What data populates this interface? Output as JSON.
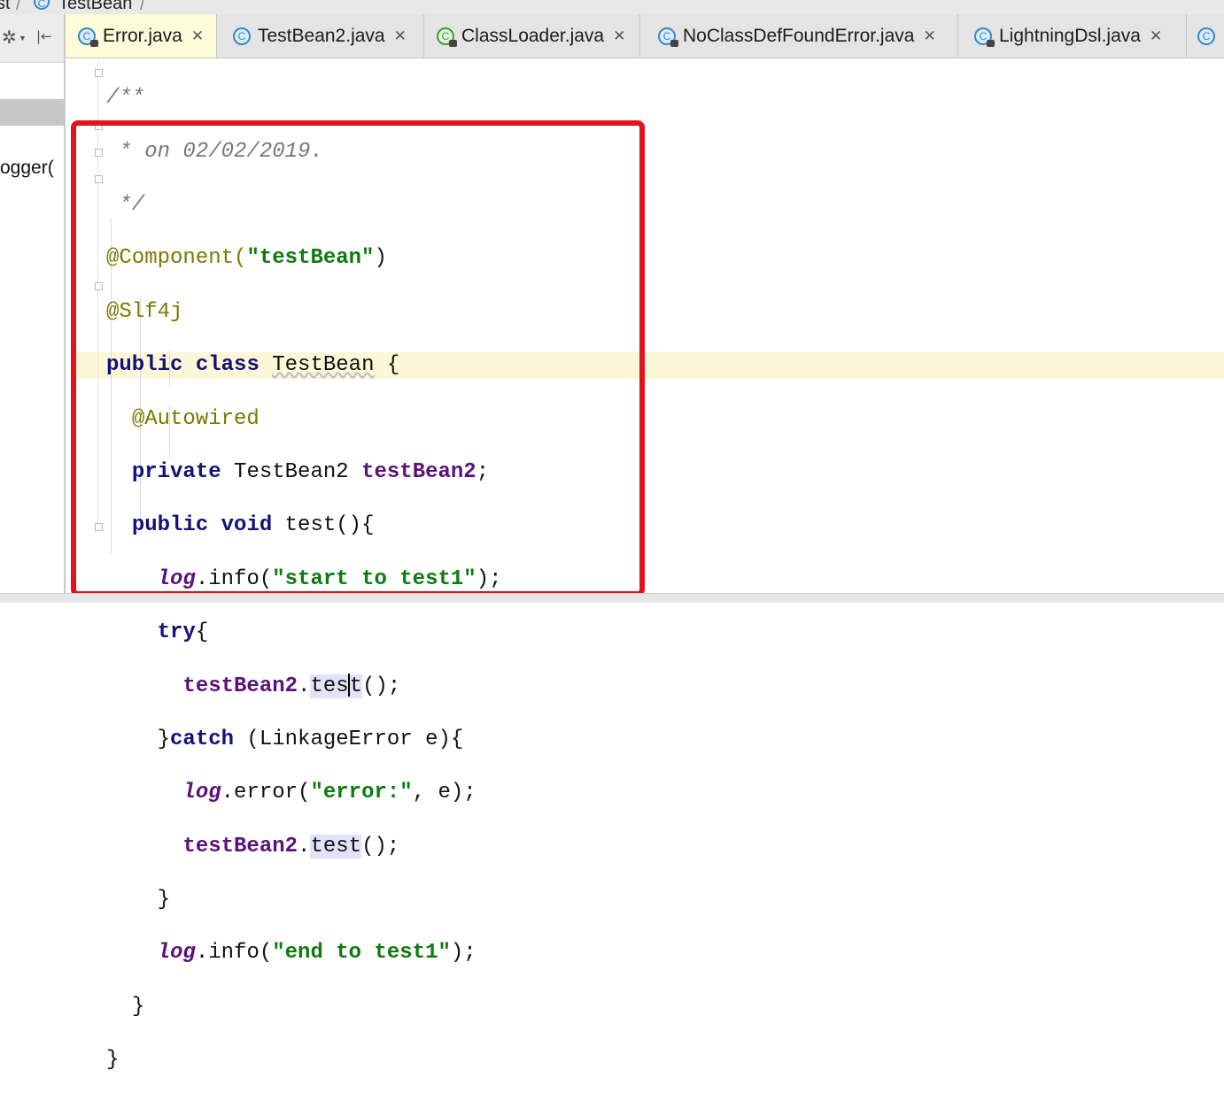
{
  "breadcrumb": {
    "prev": "st",
    "icon": "class-icon",
    "current": "TestBean"
  },
  "left_panel": {
    "partial_text": "ogger("
  },
  "tabs": [
    {
      "label": "Error.java",
      "icon": "class-lock-icon",
      "active": true
    },
    {
      "label": "TestBean2.java",
      "icon": "class-icon",
      "active": false
    },
    {
      "label": "ClassLoader.java",
      "icon": "class-green-lock-icon",
      "active": false
    },
    {
      "label": "NoClassDefFoundError.java",
      "icon": "class-lock-icon",
      "active": false
    },
    {
      "label": "LightningDsl.java",
      "icon": "class-lock-icon",
      "active": false
    },
    {
      "label": "",
      "icon": "class-icon",
      "active": false
    }
  ],
  "code": {
    "comment_open": "/**",
    "comment_body": " * on 02/02/2019.",
    "comment_close": " */",
    "ann_component": "@Component(",
    "str_testbean": "\"testBean\"",
    "paren_close": ")",
    "ann_slf4j": "@Slf4j",
    "kw_public": "public",
    "kw_class": "class",
    "class_name": "TestBean",
    "brace_open": " {",
    "ann_autowired": "@Autowired",
    "kw_private": "private",
    "type_testbean2": " TestBean2 ",
    "field_testbean2": "testBean2",
    "semicolon": ";",
    "kw_void": "void",
    "method_test_decl": " test(){",
    "log": "log",
    "dot_info": ".info(",
    "str_start": "\"start to test1\"",
    "paren_semi": ");",
    "kw_try": "try",
    "brace_only": "{",
    "dot": ".",
    "call_tes": "tes",
    "call_t": "t",
    "call_test": "test",
    "call_parens": "();",
    "catch_close": "}",
    "kw_catch": "catch",
    "catch_params": " (LinkageError e){",
    "dot_error": ".error(",
    "str_error": "\"error:\"",
    "error_tail": ", e);",
    "str_end": "\"end to test1\"",
    "close_brace": "}"
  },
  "colors": {
    "highlight_box": "#e3121c",
    "current_line": "#fcf7d7",
    "active_tab": "#fefbd8"
  }
}
